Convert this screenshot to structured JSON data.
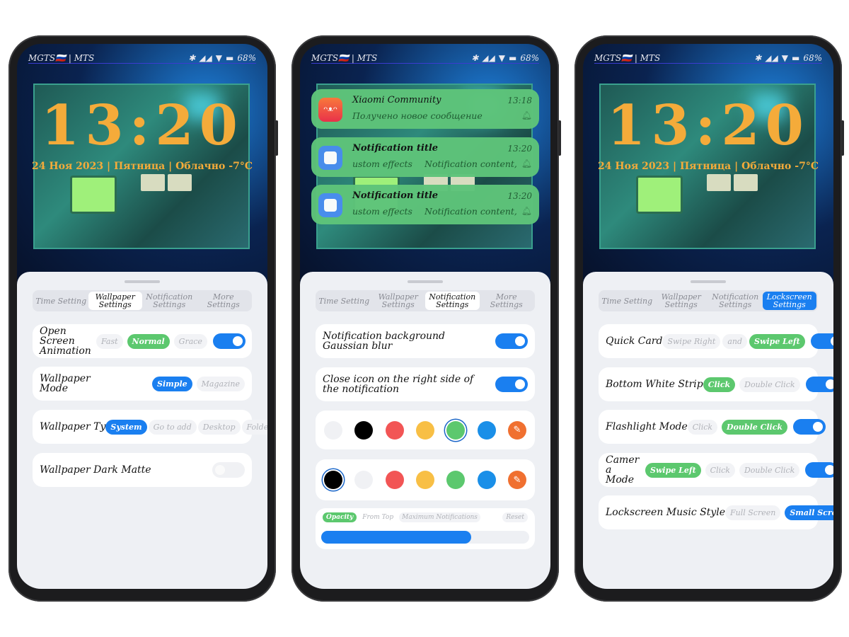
{
  "status": {
    "carrier": "MGTS🇷🇺 | MTS",
    "battery": "68%"
  },
  "lockscreen": {
    "time": "13:20",
    "date": "24 Ноя 2023 | Пятница | Облачно -7°C"
  },
  "colors": {
    "accent_blue": "#1a7ff0",
    "accent_green": "#5cc86e",
    "clock": "#f4ab3a"
  },
  "phone1": {
    "tabs": [
      "Time Setting",
      "Wallpaper Settings",
      "Notification Settings",
      "More Settings"
    ],
    "active_tab": "Wallpaper Settings",
    "rows": [
      {
        "label": "Open Screen Animation",
        "options": [
          "Fast",
          "Normal",
          "Grace"
        ],
        "selected": "Normal",
        "toggle": true
      },
      {
        "label": "Wallpaper Mode",
        "options": [
          "Simple",
          "Magazine"
        ],
        "selected": "Simple"
      },
      {
        "label": "Wallpaper Ty",
        "options": [
          "System",
          "Go to add",
          "Desktop",
          "Folder"
        ],
        "selected": "System"
      },
      {
        "label": "Wallpaper Dark Matte",
        "toggle": false
      }
    ]
  },
  "phone2": {
    "notifications": [
      {
        "app_icon": "xiaomi-community-icon",
        "title": "Xiaomi Community",
        "time": "13:18",
        "text": "Получено новое сообщение"
      },
      {
        "app_icon": "app-icon",
        "title": "Notification title",
        "time": "13:20",
        "text": "ustom effects",
        "text2": "Notification content, c"
      },
      {
        "app_icon": "app-icon",
        "title": "Notification title",
        "time": "13:20",
        "text": "ustom effects",
        "text2": "Notification content, c"
      }
    ],
    "tabs": [
      "Time Setting",
      "Wallpaper Settings",
      "Notification Settings",
      "More Settings"
    ],
    "active_tab": "Notification Settings",
    "rows": [
      {
        "label": "Notification background Gaussian blur",
        "toggle": true
      },
      {
        "label": "Close icon on the right side of the notification",
        "toggle": true
      }
    ],
    "palette1": {
      "colors": [
        "#f0f1f4",
        "#000000",
        "#f25555",
        "#f8bf45",
        "#5cc86e",
        "#1a8fe8",
        "#f07030"
      ],
      "selected": "#5cc86e"
    },
    "palette2": {
      "colors": [
        "#000000",
        "#f0f1f4",
        "#f25555",
        "#f8bf45",
        "#5cc86e",
        "#1a8fe8",
        "#f07030"
      ],
      "selected": "#000000"
    },
    "slider": {
      "options": [
        "Opacity",
        "From Top",
        "Maximum Notifications"
      ],
      "selected": "Opacity",
      "reset": "Reset",
      "value_percent": 72
    }
  },
  "phone3": {
    "tabs": [
      "Time Setting",
      "Wallpaper Settings",
      "Notification Settings",
      "Lockscreen Settings"
    ],
    "active_tab": "Lockscreen Settings",
    "rows": [
      {
        "label": "Quick Card",
        "options": [
          "Swipe Right",
          "and",
          "Swipe Left"
        ],
        "selected": "Swipe Left",
        "toggle": true
      },
      {
        "label": "Bottom White Strip",
        "options": [
          "Click",
          "Double Click"
        ],
        "selected": "Click",
        "toggle": true
      },
      {
        "label": "Flashlight Mode",
        "options": [
          "Click",
          "Double Click"
        ],
        "selected": "Double Click",
        "toggle": true
      },
      {
        "label": "Camer a Mode",
        "options": [
          "Swipe Left",
          "Click",
          "Double Click"
        ],
        "selected": "Swipe Left",
        "toggle": true
      },
      {
        "label": "Lockscreen Music Style",
        "options": [
          "Full Screen",
          "Small Screen"
        ],
        "selected": "Small Screen",
        "selected_style": "blue"
      }
    ]
  }
}
